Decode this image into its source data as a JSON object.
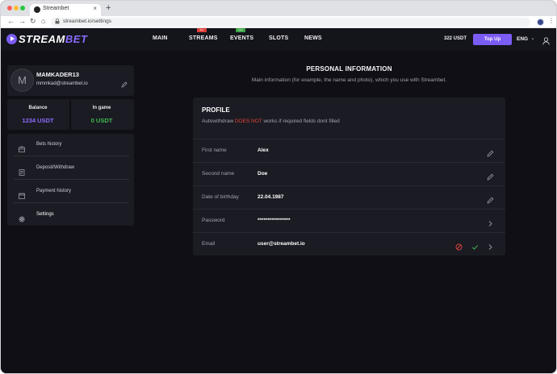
{
  "browser": {
    "tab_title": "Streambet",
    "tab_close": "×",
    "new_tab": "+",
    "back": "←",
    "forward": "→",
    "reload": "↻",
    "home": "⌂",
    "url": "streambet.io/settings",
    "menu": "⋮"
  },
  "header": {
    "logo_main": "STREAM",
    "logo_accent": "BET",
    "nav": [
      {
        "label": "MAIN"
      },
      {
        "label": "STREAMS",
        "badge": "live",
        "badge_color": "#e0403a"
      },
      {
        "label": "EVENTS",
        "badge": "new",
        "badge_color": "#3fa54a"
      },
      {
        "label": "SLOTS"
      },
      {
        "label": "NEWS"
      }
    ],
    "balance": "322 USDT",
    "topup_label": "Top Up",
    "language": "ENG",
    "lang_chevron": "⌄"
  },
  "sidebar": {
    "avatar_letter": "M",
    "username": "MAMKADER13",
    "email": "mmmkad@streambet.io",
    "balance_label": "Balance",
    "balance_value": "1234 USDT",
    "balance_color": "#8a6cff",
    "ingame_label": "In game",
    "ingame_value": "0 USDT",
    "ingame_color": "#3fb950",
    "menu": [
      {
        "label": "Bets history",
        "icon": "briefcase-icon"
      },
      {
        "label": "Deposit/Withdraw",
        "icon": "document-icon"
      },
      {
        "label": "Payment history",
        "icon": "calendar-icon"
      },
      {
        "label": "Settings",
        "icon": "gear-icon",
        "active": true
      }
    ]
  },
  "main": {
    "title": "PERSONAL INFORMATION",
    "subtitle": "Main information (for example, the name and photo), which you use with Streambet.",
    "profile_heading": "PROFILE",
    "warn_prefix": "Autowithdraw ",
    "warn_danger": "DOES NOT",
    "warn_suffix": " works if required fields dont filled",
    "danger_color": "#e5433a",
    "fields": [
      {
        "label": "First name",
        "value": "Alex",
        "action": "pencil-icon"
      },
      {
        "label": "Second name",
        "value": "Doe",
        "action": "pencil-icon"
      },
      {
        "label": "Date of birthday",
        "value": "22.04.1987",
        "action": "pencil-icon"
      },
      {
        "label": "Password",
        "value": "****************",
        "action": "chevron-right-icon"
      },
      {
        "label": "Email",
        "value": "user@streambet.io",
        "action": "chevron-right-icon",
        "status_icons": [
          "cancel-icon",
          "check-icon"
        ]
      }
    ]
  }
}
